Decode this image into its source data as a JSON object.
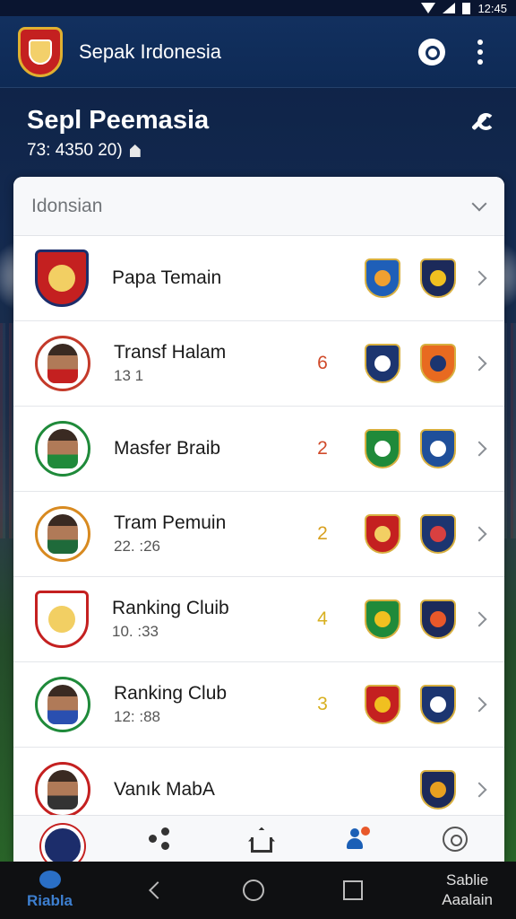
{
  "status_bar": {
    "time": "12:45"
  },
  "app_bar": {
    "title": "Sepak Irdonesia"
  },
  "header": {
    "title": "Sepl Peemasia",
    "subtitle": "73: 4350 20)"
  },
  "dropdown": {
    "label": "Idonsian"
  },
  "rows": [
    {
      "name": "Papa Temain",
      "meta": "",
      "count": "",
      "count_color": "#d04a2a",
      "avatar": "crest",
      "badges": [
        {
          "icon": "club-badge-blue",
          "color": "#1f5fb8",
          "inner": "#f0a030"
        },
        {
          "icon": "club-badge-navy",
          "color": "#1c2a5a",
          "inner": "#f0c020"
        }
      ]
    },
    {
      "name": "Transf Halam",
      "meta": "13 1",
      "count": "6",
      "count_color": "#d04a2a",
      "avatar": "player",
      "badges": [
        {
          "icon": "club-badge-navy",
          "color": "#1c3570",
          "inner": "#ffffff"
        },
        {
          "icon": "club-badge-orange",
          "color": "#e86a20",
          "inner": "#1c3570"
        }
      ]
    },
    {
      "name": "Masfer Braib",
      "meta": "",
      "count": "2",
      "count_color": "#d04a2a",
      "avatar": "player-green",
      "badges": [
        {
          "icon": "club-badge-green",
          "color": "#1f8a3a",
          "inner": "#ffffff"
        },
        {
          "icon": "club-badge-blue",
          "color": "#1f4f9a",
          "inner": "#ffffff"
        }
      ]
    },
    {
      "name": "Tram Pemuin",
      "meta": "22. :26",
      "count": "2",
      "count_color": "#d8a020",
      "avatar": "player-orange",
      "badges": [
        {
          "icon": "club-badge-red",
          "color": "#c42020",
          "inner": "#f2cf63"
        },
        {
          "icon": "club-badge-stripes",
          "color": "#1c3570",
          "inner": "#d84040"
        }
      ]
    },
    {
      "name": "Ranking Cluib",
      "meta": "10. :33",
      "count": "4",
      "count_color": "#d8b020",
      "avatar": "crest-player",
      "badges": [
        {
          "icon": "club-badge-green",
          "color": "#1f8a3a",
          "inner": "#f0c020"
        },
        {
          "icon": "club-badge-navy",
          "color": "#1c2a5a",
          "inner": "#e8582a"
        }
      ]
    },
    {
      "name": "Ranking Club",
      "meta": "12: :88",
      "count": "3",
      "count_color": "#d8b020",
      "avatar": "player-blue",
      "badges": [
        {
          "icon": "club-badge-red",
          "color": "#c42020",
          "inner": "#f0c020"
        },
        {
          "icon": "club-badge-stripes",
          "color": "#1c3570",
          "inner": "#ffffff"
        }
      ]
    },
    {
      "name": "Vanık MabA",
      "meta": "",
      "count": "",
      "count_color": "#d8b020",
      "avatar": "player-striped",
      "badges": [
        {
          "icon": "club-badge-navy",
          "color": "#1c2a5a",
          "inner": "#e8a020"
        }
      ]
    }
  ],
  "system_nav": {
    "app_label": "Riabla",
    "right_label_1": "Sablie",
    "right_label_2": "Aaalain"
  }
}
